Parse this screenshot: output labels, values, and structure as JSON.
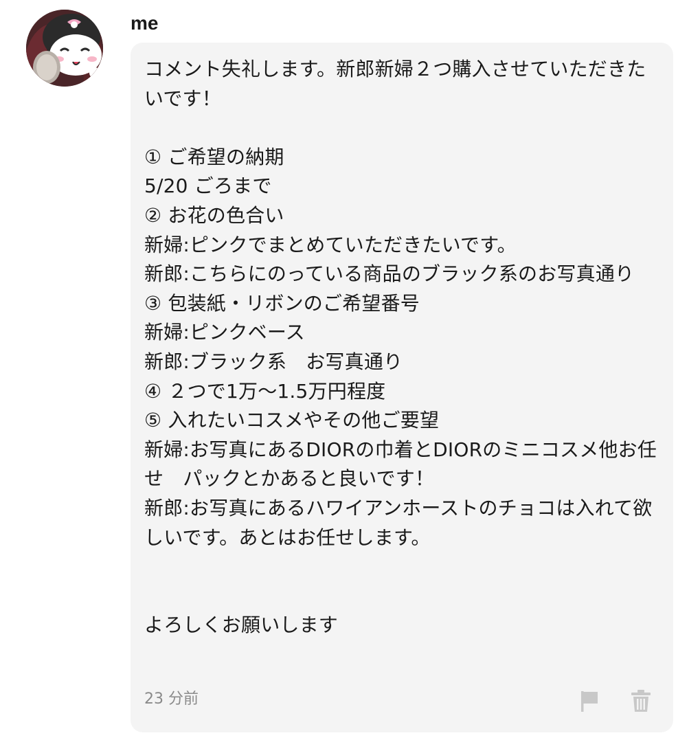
{
  "comment": {
    "author": "me",
    "avatar_icon": "character-avatar-icon",
    "message": "コメント失礼します。新郎新婦２つ購入させていただきたいです！\n\n① ご希望の納期\n5/20 ごろまで\n② お花の色合い\n新婦:ピンクでまとめていただきたいです。\n新郎:こちらにのっている商品のブラック系のお写真通り\n③ 包装紙・リボンのご希望番号\n新婦:ピンクベース\n新郎:ブラック系　お写真通り\n④ ２つで1万〜1.5万円程度\n⑤ 入れたいコスメやその他ご要望\n新婦:お写真にあるDIORの巾着とDIORのミニコスメ他お任せ　パックとかあると良いです！\n新郎:お写真にあるハワイアンホーストのチョコは入れて欲しいです。あとはお任せします。\n\n\nよろしくお願いします",
    "timestamp": "23 分前",
    "actions": {
      "report_icon": "flag-icon",
      "delete_icon": "trash-icon"
    }
  },
  "colors": {
    "bubble_background": "#f4f4f4",
    "text": "#1a1a1a",
    "muted_text": "#8a8a8a",
    "icon": "#c8c8c8"
  }
}
